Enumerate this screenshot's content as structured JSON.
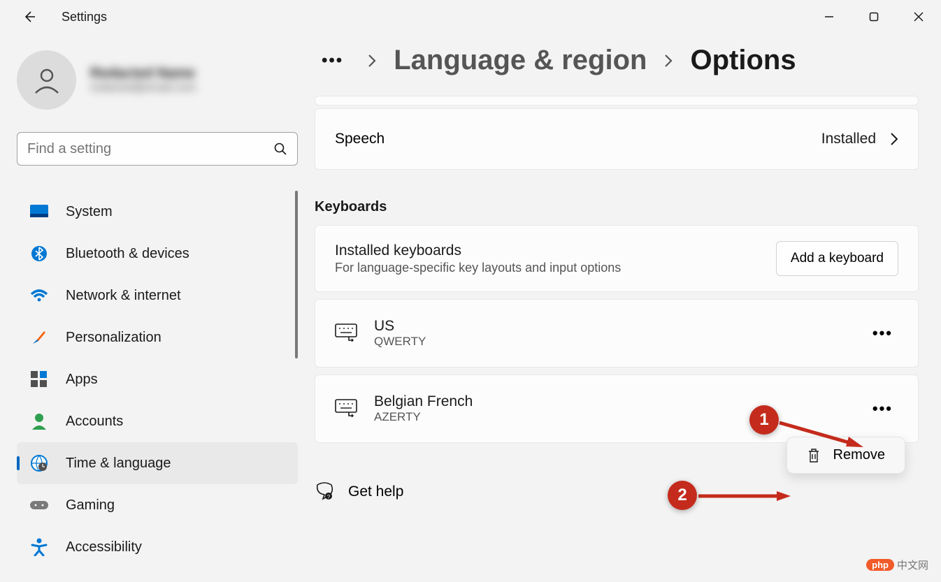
{
  "window": {
    "title": "Settings"
  },
  "user": {
    "name": "Redacted Name",
    "email": "redacted@email.com"
  },
  "search": {
    "placeholder": "Find a setting"
  },
  "nav": {
    "items": [
      {
        "label": "System"
      },
      {
        "label": "Bluetooth & devices"
      },
      {
        "label": "Network & internet"
      },
      {
        "label": "Personalization"
      },
      {
        "label": "Apps"
      },
      {
        "label": "Accounts"
      },
      {
        "label": "Time & language"
      },
      {
        "label": "Gaming"
      },
      {
        "label": "Accessibility"
      }
    ],
    "active_index": 6
  },
  "breadcrumb": {
    "link": "Language & region",
    "current": "Options"
  },
  "speech": {
    "label": "Speech",
    "status": "Installed"
  },
  "keyboards": {
    "section_title": "Keyboards",
    "installed_title": "Installed keyboards",
    "installed_sub": "For language-specific key layouts and input options",
    "add_button": "Add a keyboard",
    "items": [
      {
        "name": "US",
        "layout": "QWERTY"
      },
      {
        "name": "Belgian French",
        "layout": "AZERTY"
      }
    ]
  },
  "context_menu": {
    "remove": "Remove"
  },
  "help": {
    "label": "Get help"
  },
  "annotations": {
    "badge1": "1",
    "badge2": "2"
  },
  "watermark": {
    "pill": "php",
    "text": "中文网"
  }
}
